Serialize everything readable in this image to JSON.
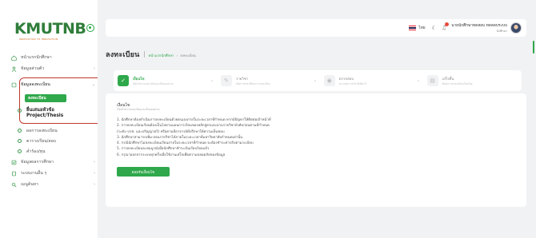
{
  "brand": {
    "logo_text_k": "K",
    "logo_text_rest": "MUTNB",
    "logo_tagline": "INNOVATION TO INNOVATION"
  },
  "sidebar": {
    "items": [
      {
        "label": "หน้าแรกนักศึกษา",
        "icon": "home-icon"
      },
      {
        "label": "ข้อมูลส่วนตัว",
        "icon": "user-icon"
      },
      {
        "label": "ข้อมูลลงทะเบียน",
        "icon": "book-icon"
      },
      {
        "label": "ผลการลงทะเบียน",
        "icon": "circle-icon"
      },
      {
        "label": "ตารางเรียน/สอบ",
        "icon": "circle-icon"
      },
      {
        "label": "คำร้อง/ทุน",
        "icon": "circle-icon"
      },
      {
        "label": "ข้อมูลผลการศึกษา",
        "icon": "checkbox-icon"
      },
      {
        "label": "ระบบงานอื่น ๆ",
        "icon": "document-icon"
      },
      {
        "label": "เมนูค้นหา",
        "icon": "search-icon"
      }
    ],
    "submenu": {
      "active": "ลงทะเบียน",
      "thesis_line1": "ยื่นเสนอหัวข้อ",
      "thesis_line2": "Project/Thesis"
    }
  },
  "topbar": {
    "lang": "ไทย",
    "user_name": "นายนักศึกษาทดสอบ ทดสอบระบบ",
    "user_role": "นักศึกษา"
  },
  "page": {
    "title": "ลงทะเบียน",
    "breadcrumb_home": "หน้าแรกนักศึกษา",
    "breadcrumb_current": "ลงทะเบียน"
  },
  "steps": [
    {
      "title": "เงื่อนไข",
      "sub": "เงื่อนไขการลงทะเบียนและขั้นตอนต่างๆ"
    },
    {
      "title": "รายวิชา",
      "sub": "เลือกรายวิชาที่ต้องการลงทะเบียน"
    },
    {
      "title": "ตรวจสอบ",
      "sub": "ตรวจสอบรายวิชาที่เลือกไว้"
    },
    {
      "title": "เสร็จสิ้น",
      "sub": "ยืนยันการลงทะเบียนเรียบร้อย"
    }
  ],
  "card": {
    "title": "เงื่อนไข",
    "subtitle": "เงื่อนไขการลงทะเบียนและขั้นตอนต่างๆ",
    "rules": [
      "1. นักศึกษาต้องดำเนินการลงทะเบียนด้วยตนเองภายในระยะเวลาที่กำหนด หากมีปัญหาให้ติดต่อเจ้าหน้าที่",
      "2. การลงทะเบียนเรียนต้องเป็นไปตามแผนการเรียนของหลักสูตรและผ่านรายวิชาบังคับก่อนตามที่กำหนด",
      "   (ระดับ ปวช. และปริญญาตรี) หรือตามที่อาจารย์ที่ปรึกษาให้ความเห็นชอบ",
      "3. นักศึกษาสามารถเพิ่ม-ถอนรายวิชาได้ภายในระยะเวลาที่มหาวิทยาลัยกำหนดเท่านั้น",
      "4. กรณีนักศึกษาไม่ลงทะเบียนเรียนภายในระยะเวลาที่กำหนด จะต้องชำระค่าปรับตามระเบียบ",
      "5. การลงทะเบียนจะสมบูรณ์เมื่อนักศึกษาชำระเงินเรียบร้อยแล้ว",
      "6. กรุณาออกจากระบบทุกครั้งเมื่อใช้งานเสร็จเพื่อความปลอดภัยของข้อมูล"
    ],
    "button": "ยอมรับเงื่อนไข"
  }
}
